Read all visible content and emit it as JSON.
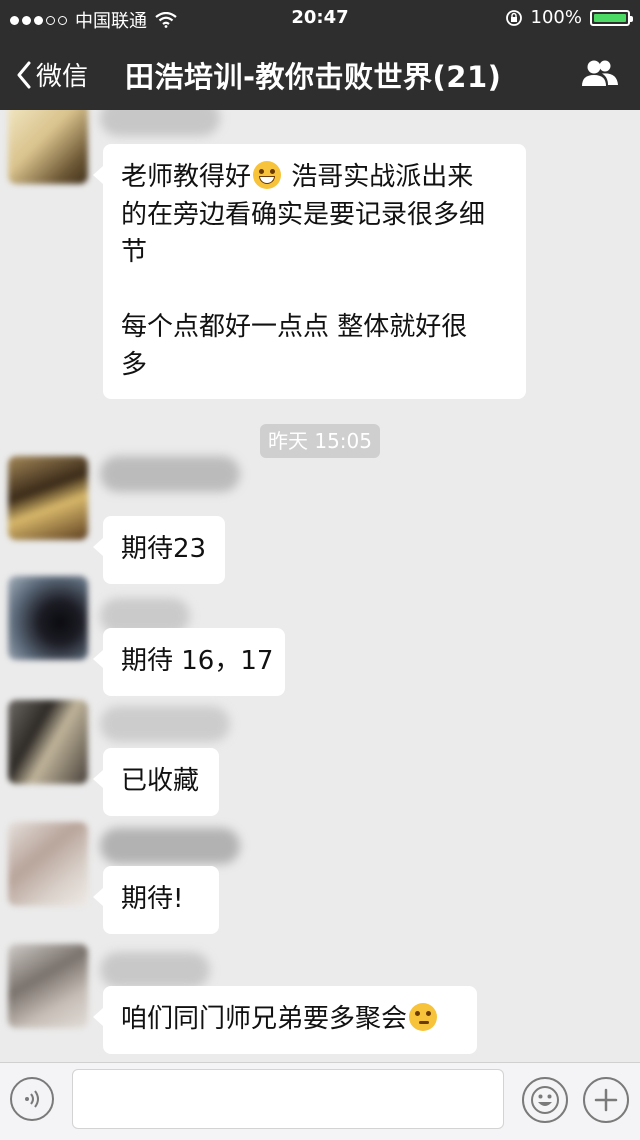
{
  "status_bar": {
    "carrier": "中国联通",
    "time": "20:47",
    "battery": "100%",
    "battery_level": 1.0
  },
  "nav": {
    "back_label": "微信",
    "title": "田浩培训-教你击败世界(21)"
  },
  "messages": [
    {
      "lines": [
        "老师教得好",
        "浩哥实战派出来",
        "的在旁边看确实是要记录很多细",
        "节",
        "",
        "每个点都好一点点 整体就好很",
        "多"
      ],
      "emoji": "grin-emoji"
    },
    {
      "text": "期待23"
    },
    {
      "text": "期待 16，17"
    },
    {
      "text": "已收藏"
    },
    {
      "text": "期待!"
    },
    {
      "text": "咱们同门师兄弟要多聚会",
      "emoji": "thinking-emoji"
    }
  ],
  "timestamp": "昨天 15:05",
  "input": {
    "value": "",
    "placeholder": ""
  },
  "colors": {
    "header_bg": "#2e2e2e",
    "chat_bg": "#ebebeb",
    "bubble_bg": "#ffffff",
    "battery_fill": "#4cd964",
    "timestamp_bg": "#cfcfcf"
  }
}
